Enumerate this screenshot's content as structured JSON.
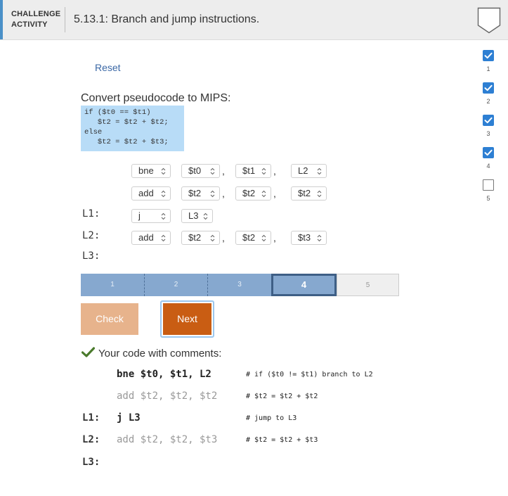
{
  "header": {
    "activity_label_line1": "CHALLENGE",
    "activity_label_line2": "ACTIVITY",
    "title": "5.13.1: Branch and jump instructions."
  },
  "progress": [
    {
      "number": "1",
      "state": "done"
    },
    {
      "number": "2",
      "state": "done"
    },
    {
      "number": "3",
      "state": "done"
    },
    {
      "number": "4",
      "state": "done"
    },
    {
      "number": "5",
      "state": "todo"
    }
  ],
  "reset_label": "Reset",
  "prompt": "Convert pseudocode to MIPS:",
  "pseudocode": "if ($t0 == $t1)\n   $t2 = $t2 + $t2;\nelse\n   $t2 = $t2 + $t3;",
  "instructions": [
    {
      "label": "",
      "op": "bne",
      "args": [
        "$t0",
        "$t1",
        "L2"
      ]
    },
    {
      "label": "",
      "op": "add",
      "args": [
        "$t2",
        "$t2",
        "$t2"
      ]
    },
    {
      "label": "L1:",
      "op": "j",
      "args": [
        "L3"
      ]
    },
    {
      "label": "L2:",
      "op": "add",
      "args": [
        "$t2",
        "$t2",
        "$t3"
      ]
    },
    {
      "label": "L3:",
      "op": "",
      "args": []
    }
  ],
  "comma": ",",
  "levels": {
    "items": [
      "1",
      "2",
      "3",
      "4",
      "5"
    ],
    "current": 4
  },
  "buttons": {
    "check": "Check",
    "next": "Next"
  },
  "feedback": {
    "message": "Your code with comments:",
    "lines": [
      {
        "label": "",
        "code": "bne $t0, $t1, L2",
        "style": "bold",
        "comment": "# if ($t0 != $t1) branch to L2"
      },
      {
        "label": "",
        "code": "add $t2, $t2, $t2",
        "style": "gray",
        "comment": "# $t2 = $t2 + $t2"
      },
      {
        "label": "L1:",
        "code": "j L3",
        "style": "bold",
        "comment": "# jump to L3"
      },
      {
        "label": "L2:",
        "code": "add $t2, $t2, $t3",
        "style": "gray",
        "comment": "# $t2 = $t2 + $t3"
      },
      {
        "label": "L3:",
        "code": "",
        "style": "bold",
        "comment": ""
      }
    ]
  },
  "colors": {
    "accent": "#4a90c8",
    "done": "#2d7fd3",
    "next_button": "#c95d13",
    "check_button": "#e7b38c",
    "success": "#4a7a2c"
  },
  "icons": {
    "shield": "shield-outline-icon",
    "check": "check-mark-icon",
    "chevron": "up-down-chevron-icon"
  }
}
